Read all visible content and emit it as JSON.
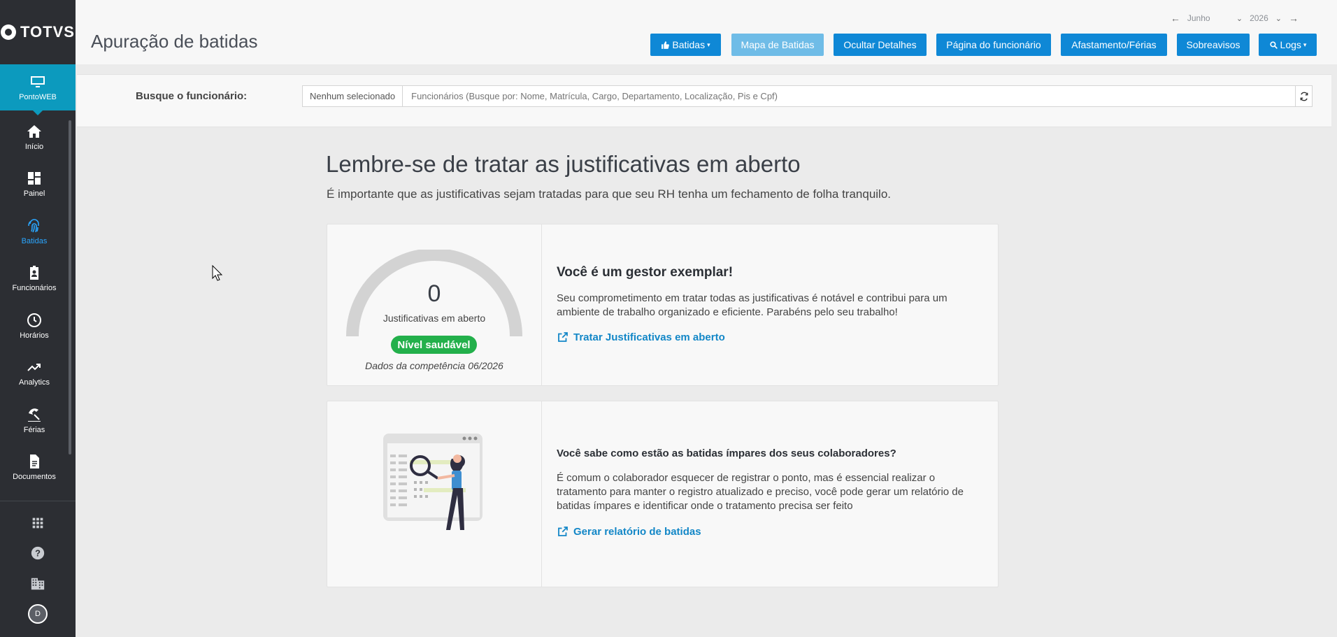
{
  "sidebar": {
    "logo": "TOTVS",
    "active_module": "PontoWEB",
    "items": [
      {
        "label": "Início",
        "icon": "home-icon"
      },
      {
        "label": "Painel",
        "icon": "dashboard-icon"
      },
      {
        "label": "Batidas",
        "icon": "fingerprint-icon"
      },
      {
        "label": "Funcionários",
        "icon": "badge-icon"
      },
      {
        "label": "Horários",
        "icon": "clock-icon"
      },
      {
        "label": "Analytics",
        "icon": "trending-up-icon"
      },
      {
        "label": "Férias",
        "icon": "beach-umbrella-icon"
      },
      {
        "label": "Documentos",
        "icon": "document-icon"
      }
    ],
    "selected_item": "Batidas",
    "avatar_initial": "D"
  },
  "header": {
    "title": "Apuração de batidas",
    "period": {
      "month": "Junho",
      "year": "2026"
    },
    "buttons": {
      "batidas": "Batidas",
      "mapa": "Mapa de Batidas",
      "ocultar": "Ocultar Detalhes",
      "pagina": "Página do funcionário",
      "afastamento": "Afastamento/Férias",
      "sobreavisos": "Sobreavisos",
      "logs": "Logs"
    }
  },
  "search": {
    "label": "Busque o funcionário:",
    "selected": "Nenhum selecionado",
    "placeholder": "Funcionários (Busque por: Nome, Matrícula, Cargo, Departamento, Localização, Pis e Cpf)"
  },
  "main": {
    "title": "Lembre-se de tratar as justificativas em aberto",
    "subtitle": "É importante que as justificativas sejam tratadas para que seu RH tenha um fechamento de folha tranquilo."
  },
  "card1": {
    "count": "0",
    "count_label": "Justificativas em aberto",
    "status": "Nível saudável",
    "competencia": "Dados da competência 06/2026",
    "heading": "Você é um gestor exemplar!",
    "text": "Seu comprometimento em tratar todas as justificativas é notável e contribui para um ambiente de trabalho organizado e eficiente. Parabéns pelo seu trabalho!",
    "link": "Tratar Justificativas em aberto"
  },
  "card2": {
    "heading": "Você sabe como estão as batidas ímpares dos seus colaboradores?",
    "text": "É comum o colaborador esquecer de registrar o ponto, mas é essencial realizar o tratamento para manter o registro atualizado e preciso, você pode gerar um relatório de batidas ímpares e identificar onde o tratamento precisa ser feito",
    "link": "Gerar relatório de batidas"
  },
  "colors": {
    "sidebar_bg": "#2c2e33",
    "active_module": "#0c9abe",
    "button": "#0f88d6",
    "healthy_badge": "#23b04b",
    "link": "#1387c7"
  }
}
